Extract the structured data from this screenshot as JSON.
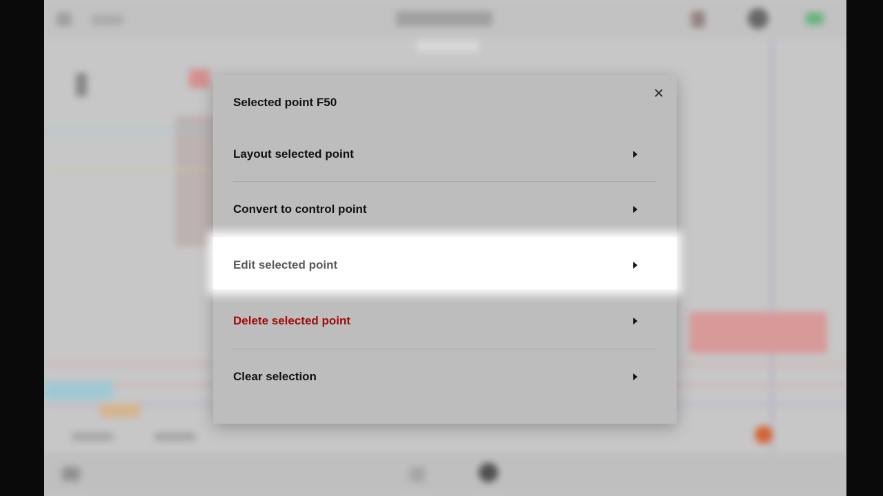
{
  "dialog": {
    "title": "Selected point F50",
    "items": [
      {
        "label": "Layout selected point",
        "icon": "chevron-right-icon"
      },
      {
        "label": "Convert to control point",
        "icon": "chevron-right-icon"
      },
      {
        "label": "Edit selected point",
        "icon": "chevron-right-icon",
        "state": "highlighted"
      },
      {
        "label": "Delete selected point",
        "icon": "chevron-right-icon",
        "color": "#9e0b0b"
      },
      {
        "label": "Clear selection",
        "icon": "chevron-right-icon"
      }
    ],
    "close_icon": "close-icon"
  },
  "colors": {
    "dialog_bg": "#bdbdbd",
    "danger": "#9e0b0b",
    "highlight": "#ffffff"
  }
}
